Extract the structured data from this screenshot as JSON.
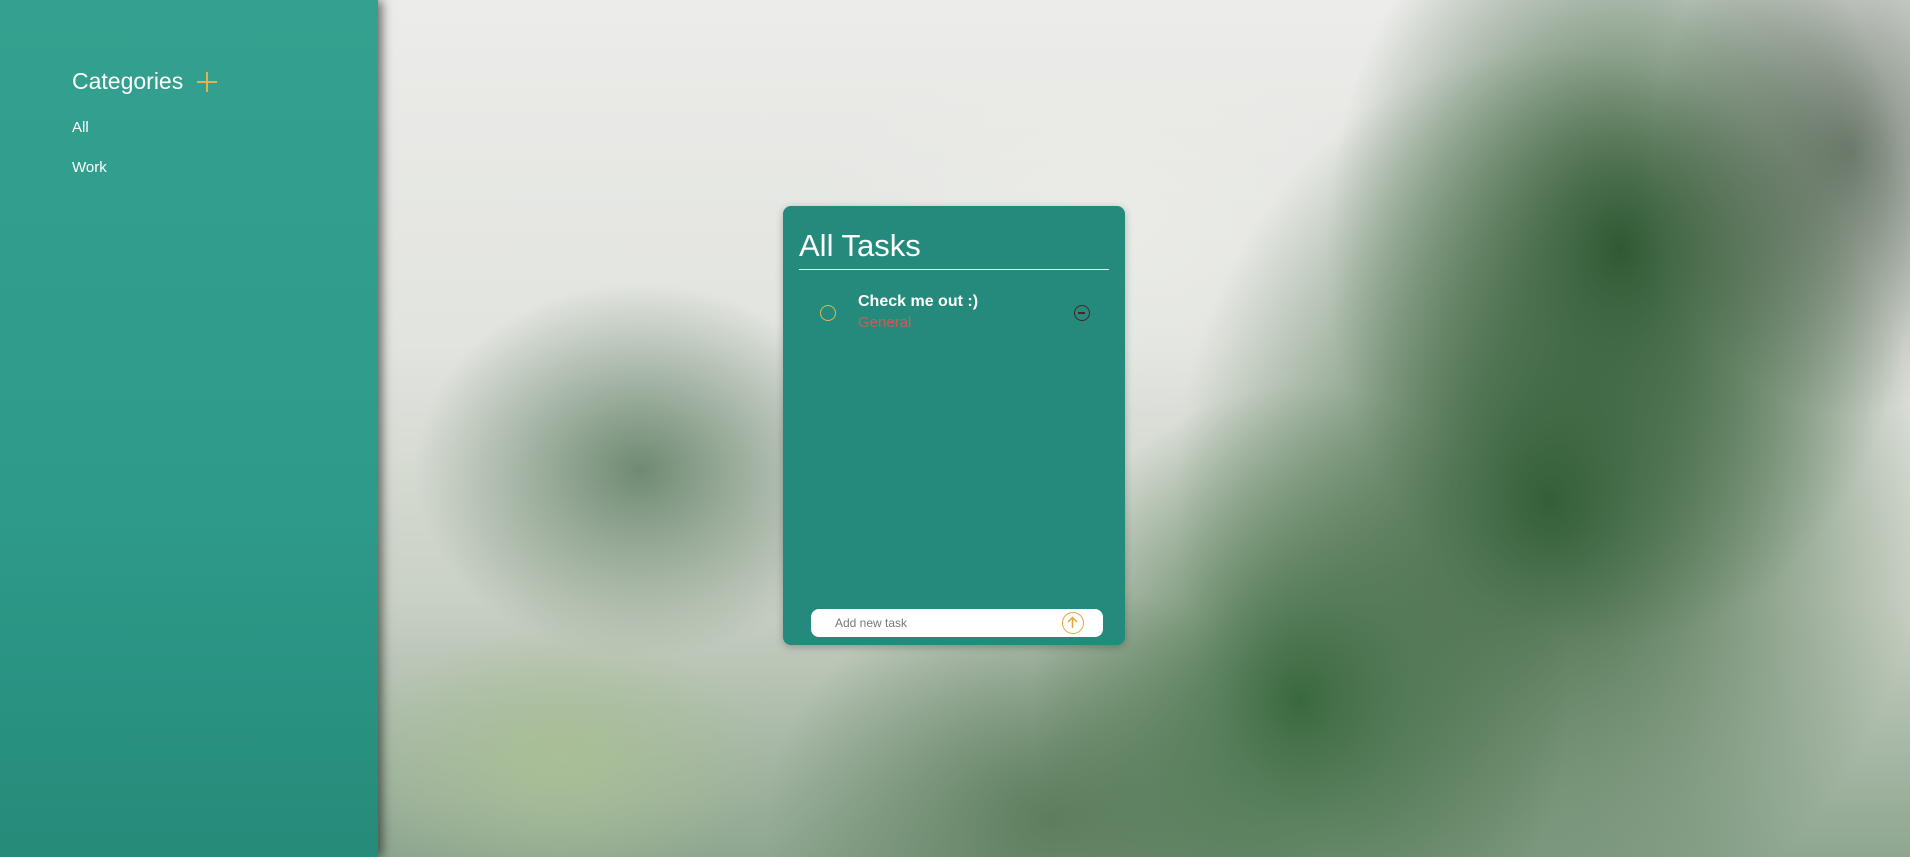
{
  "sidebar": {
    "title": "Categories",
    "add_icon": "plus-icon",
    "items": [
      {
        "label": "All"
      },
      {
        "label": "Work"
      }
    ]
  },
  "card": {
    "title": "All Tasks",
    "tasks": [
      {
        "text": "Check me out :)",
        "category": "General"
      }
    ],
    "input": {
      "placeholder": "Add new task",
      "value": ""
    },
    "submit_icon": "arrow-up-circle-icon"
  },
  "colors": {
    "sidebar": "#2e9a8a",
    "card": "#248a7c",
    "accent": "#e0a836",
    "task_category": "#c85f52"
  }
}
